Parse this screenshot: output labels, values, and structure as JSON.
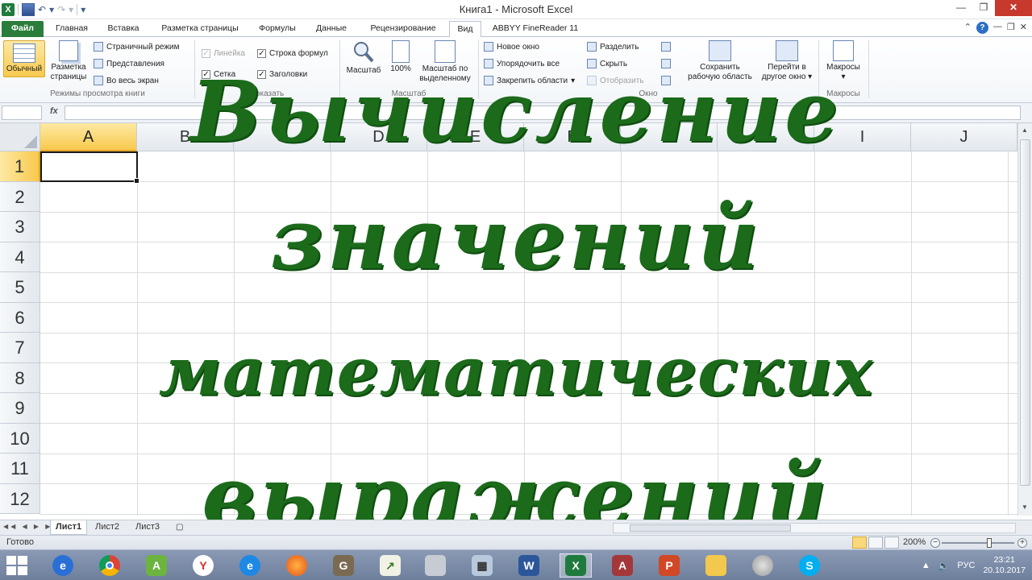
{
  "window": {
    "title": "Книга1  -  Microsoft Excel"
  },
  "ribbon_tabs": [
    {
      "label": "Файл"
    },
    {
      "label": "Главная"
    },
    {
      "label": "Вставка"
    },
    {
      "label": "Разметка страницы"
    },
    {
      "label": "Формулы"
    },
    {
      "label": "Данные"
    },
    {
      "label": "Рецензирование"
    },
    {
      "label": "Вид"
    },
    {
      "label": "ABBYY FineReader 11"
    }
  ],
  "ribbon": {
    "views_group": {
      "normal": "Обычный",
      "page_layout_1": "Разметка",
      "page_layout_2": "страницы",
      "page_mode": "Страничный режим",
      "custom_views": "Представления",
      "full_screen": "Во весь экран",
      "label": "Режимы просмотра книги"
    },
    "show_group": {
      "ruler": "Линейка",
      "formula_bar": "Строка формул",
      "gridlines": "Сетка",
      "headings": "Заголовки",
      "label": "Показать"
    },
    "zoom_group": {
      "zoom": "Масштаб",
      "zoom100": "100%",
      "zoom_selection_1": "Масштаб по",
      "zoom_selection_2": "выделенному",
      "label": "Масштаб"
    },
    "window_group": {
      "new_window": "Новое окно",
      "arrange_all": "Упорядочить все",
      "freeze_panes": "Закрепить области",
      "split": "Разделить",
      "hide": "Скрыть",
      "unhide": "Отобразить",
      "save_workspace_1": "Сохранить",
      "save_workspace_2": "рабочую область",
      "switch_windows_1": "Перейти в",
      "switch_windows_2": "другое окно",
      "label": "Окно"
    },
    "macros_group": {
      "macros": "Макросы",
      "label": "Макросы"
    }
  },
  "formula_bar": {
    "fx": "fx",
    "value": ""
  },
  "grid": {
    "columns": [
      "A",
      "B",
      "C",
      "D",
      "E",
      "F",
      "G",
      "H",
      "I",
      "J"
    ],
    "rows": [
      "1",
      "2",
      "3",
      "4",
      "5",
      "6",
      "7",
      "8",
      "9",
      "10",
      "11",
      "12"
    ],
    "active_cell": "A1"
  },
  "overlay_text": {
    "line1": "Вычисление",
    "line2": "значений",
    "line3": "математических",
    "line4": "выражений",
    "color": "#1b6b1b"
  },
  "sheets": [
    {
      "label": "Лист1"
    },
    {
      "label": "Лист2"
    },
    {
      "label": "Лист3"
    }
  ],
  "status": {
    "ready": "Готово",
    "zoom": "200%"
  },
  "taskbar": {
    "apps": [
      "ie-icon",
      "chrome-icon",
      "android-icon",
      "yandex-icon",
      "edge-icon",
      "firefox-icon",
      "gimp-icon",
      "chart-icon",
      "scanner-icon",
      "calculator-icon",
      "word-icon",
      "excel-icon",
      "access-icon",
      "powerpoint-icon",
      "folder-icon",
      "paint-icon",
      "skype-icon"
    ],
    "lang": "РУС",
    "time": "23:21",
    "date": "20.10.2017"
  }
}
